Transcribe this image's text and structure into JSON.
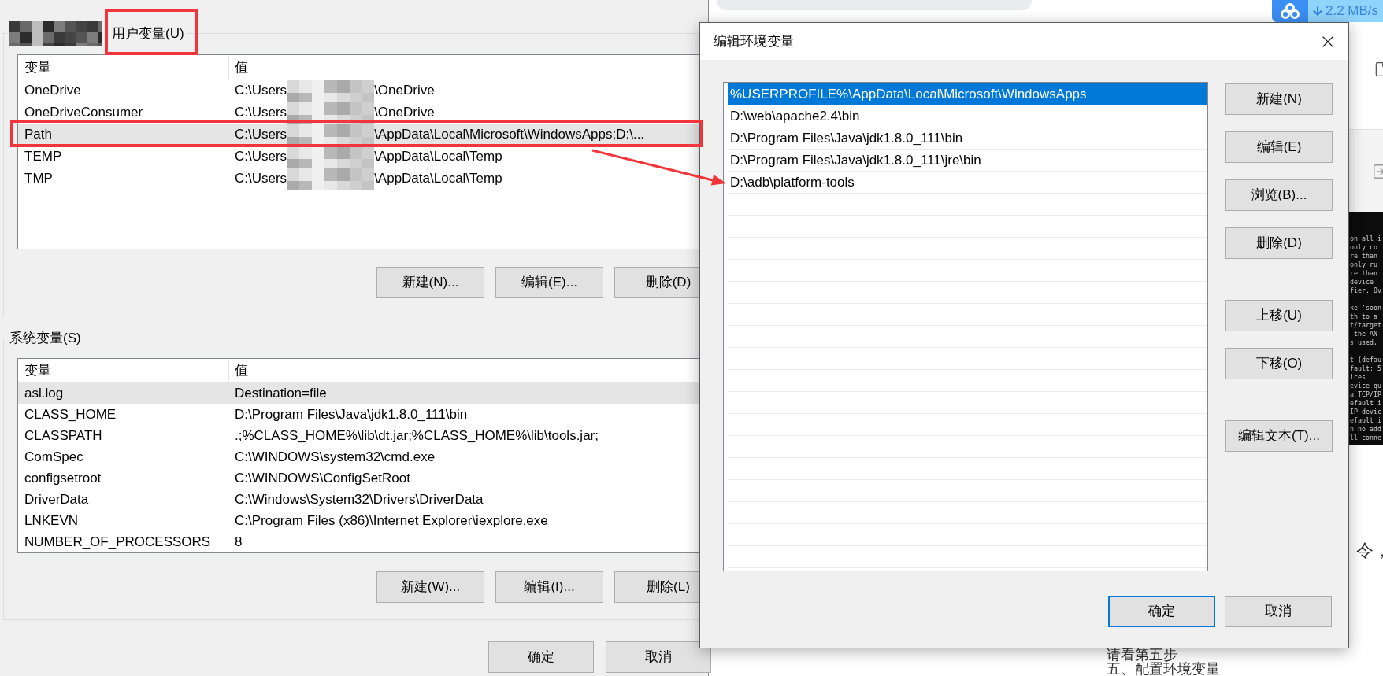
{
  "user_vars": {
    "title": "用户变量(U)",
    "title_redacted": true,
    "columns": [
      "变量",
      "值"
    ],
    "rows": [
      {
        "name": "OneDrive",
        "value": "C:\\Users",
        "value_end": "\\OneDrive",
        "redacted": true,
        "selected": false
      },
      {
        "name": "OneDriveConsumer",
        "value": "C:\\Users",
        "value_end": "\\OneDrive",
        "redacted": true,
        "selected": false
      },
      {
        "name": "Path",
        "value": "C:\\Users",
        "value_end": "\\AppData\\Local\\Microsoft\\WindowsApps;D:\\...",
        "redacted": true,
        "selected": true
      },
      {
        "name": "TEMP",
        "value": "C:\\Users",
        "value_end": "\\AppData\\Local\\Temp",
        "redacted": true,
        "selected": false
      },
      {
        "name": "TMP",
        "value": "C:\\Users",
        "value_end": "\\AppData\\Local\\Temp",
        "redacted": true,
        "selected": false
      }
    ],
    "buttons": [
      "新建(N)...",
      "编辑(E)...",
      "删除(D)"
    ]
  },
  "system_vars": {
    "title": "系统变量(S)",
    "columns": [
      "变量",
      "值"
    ],
    "rows": [
      {
        "name": "asl.log",
        "value": "Destination=file",
        "selected": true
      },
      {
        "name": "CLASS_HOME",
        "value": "D:\\Program Files\\Java\\jdk1.8.0_111\\bin",
        "selected": false
      },
      {
        "name": "CLASSPATH",
        "value": ".;%CLASS_HOME%\\lib\\dt.jar;%CLASS_HOME%\\lib\\tools.jar;",
        "selected": false
      },
      {
        "name": "ComSpec",
        "value": "C:\\WINDOWS\\system32\\cmd.exe",
        "selected": false
      },
      {
        "name": "configsetroot",
        "value": "C:\\WINDOWS\\ConfigSetRoot",
        "selected": false
      },
      {
        "name": "DriverData",
        "value": "C:\\Windows\\System32\\Drivers\\DriverData",
        "selected": false
      },
      {
        "name": "LNKEVN",
        "value": "C:\\Program Files (x86)\\Internet Explorer\\iexplore.exe",
        "selected": false
      },
      {
        "name": "NUMBER_OF_PROCESSORS",
        "value": "8",
        "selected": false
      }
    ],
    "buttons": [
      "新建(W)...",
      "编辑(I)...",
      "删除(L)"
    ]
  },
  "dialog_buttons": [
    "确定",
    "取消"
  ],
  "edit_dialog": {
    "title": "编辑环境变量",
    "items": [
      {
        "text": "%USERPROFILE%\\AppData\\Local\\Microsoft\\WindowsApps",
        "selected": true
      },
      {
        "text": "D:\\web\\apache2.4\\bin",
        "selected": false
      },
      {
        "text": "D:\\Program Files\\Java\\jdk1.8.0_111\\bin",
        "selected": false
      },
      {
        "text": "D:\\Program Files\\Java\\jdk1.8.0_111\\jre\\bin",
        "selected": false
      },
      {
        "text": "D:\\adb\\platform-tools",
        "selected": false
      }
    ],
    "side_buttons": [
      [
        "新建(N)",
        "编辑(E)",
        "浏览(B)...",
        "删除(D)"
      ],
      [
        "上移(U)",
        "下移(O)"
      ],
      [
        "编辑文本(T)..."
      ]
    ],
    "buttons": [
      {
        "label": "确定",
        "focused": true
      },
      {
        "label": "取消",
        "focused": false
      }
    ]
  },
  "browser": {
    "download_speed": "2.2 MB/s",
    "terminal_blocks": [
      [
        "on all i",
        "only co",
        "re than",
        "only ru",
        "re than",
        "device",
        "fier. Ov"
      ],
      [
        "ke 'soon",
        "th to a",
        "t/target",
        " the AN",
        "s used,"
      ],
      [
        "t (defau",
        "fault: 5",
        "ices",
        "evice qu",
        "a TCP/IP",
        "efault i",
        "IP devic",
        "efault i",
        "n no add",
        "ll conne"
      ]
    ],
    "side_text": "令，",
    "footer_lines": [
      "请看第五步",
      "五、配置环境变量"
    ]
  }
}
